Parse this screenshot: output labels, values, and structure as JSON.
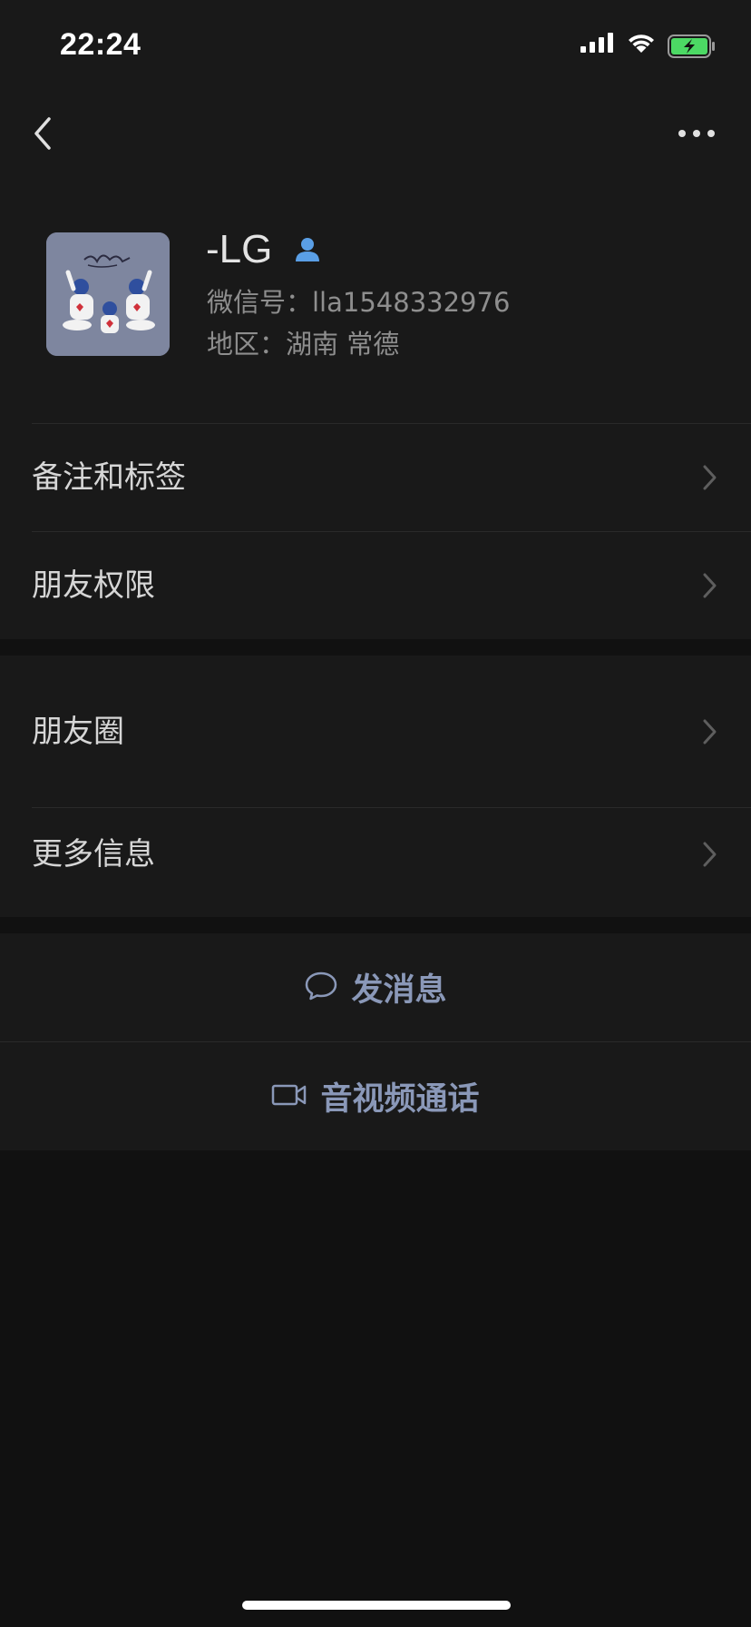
{
  "status_bar": {
    "time": "22:24"
  },
  "nav": {
    "back_icon": "chevron-left-icon",
    "more_icon": "more-icon"
  },
  "profile": {
    "name": "-LG",
    "id_label": "微信号：lla1548332976",
    "region_label": "地区：湖南 常德",
    "avatar_bg": "#7e869f"
  },
  "menu": {
    "group1": [
      {
        "label": "备注和标签"
      },
      {
        "label": "朋友权限"
      }
    ],
    "group2": [
      {
        "label": "朋友圈"
      },
      {
        "label": "更多信息"
      }
    ]
  },
  "actions": {
    "message_label": "发消息",
    "call_label": "音视频通话"
  },
  "colors": {
    "background": "#111111",
    "surface": "#191919",
    "accent_link": "#8a98b8",
    "contact_icon": "#5a9fe6",
    "battery_green": "#4cd964"
  }
}
